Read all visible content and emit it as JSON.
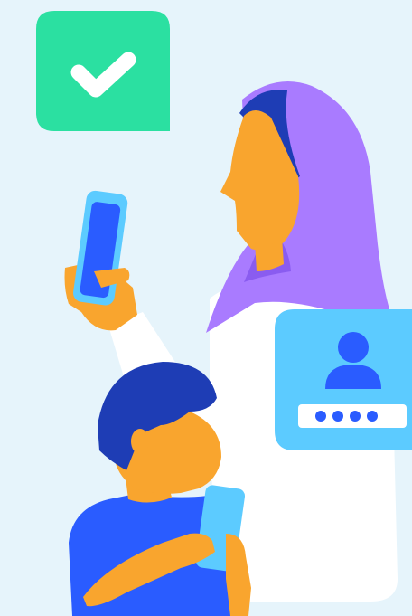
{
  "illustration": {
    "background": "#E6F4FB",
    "badge_icon": "checkmark-icon",
    "login_icon": "user-login-icon",
    "password_mask": "••••",
    "colors": {
      "check_badge": "#2BE0A1",
      "hijab": "#A97BFF",
      "hijab_shadow": "#8A5CF0",
      "hair": "#1E3DB5",
      "skin": "#F9A52E",
      "white_clothing": "#FFFFFF",
      "phone_frame": "#5CCBFF",
      "phone_screen": "#2A5CFF",
      "boy_shirt": "#2A5CFF",
      "login_card": "#5CCBFF",
      "login_accent": "#2A5CFF"
    }
  }
}
